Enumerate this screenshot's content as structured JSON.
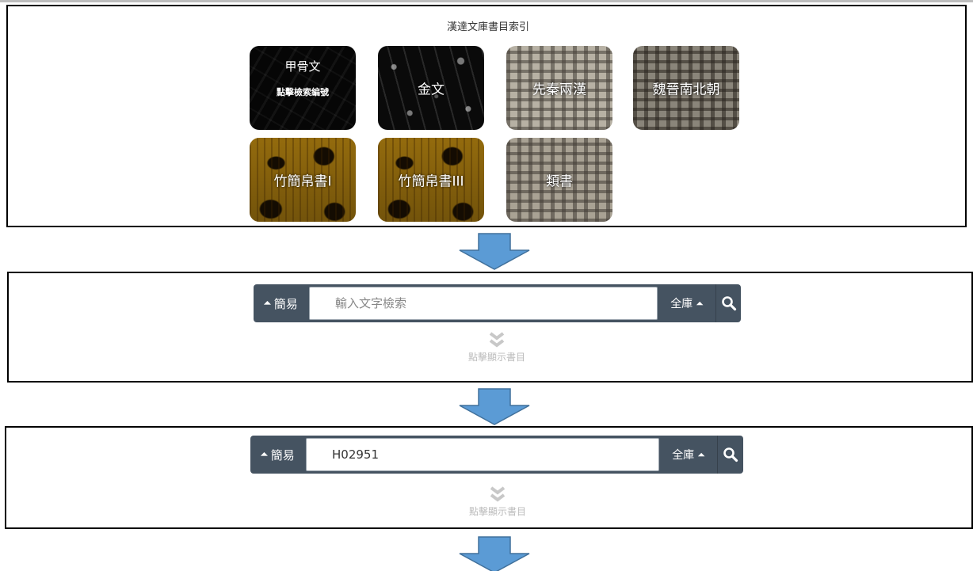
{
  "index": {
    "title": "漢達文庫書目索引",
    "tiles": [
      {
        "label": "甲骨文",
        "sublabel": "點擊檢索編號",
        "texture": "oracle-bone"
      },
      {
        "label": "金文",
        "texture": "bronze"
      },
      {
        "label": "先秦兩漢",
        "texture": "printed-text"
      },
      {
        "label": "魏晉南北朝",
        "texture": "printed-text"
      },
      {
        "label": "竹簡帛書I",
        "texture": "bamboo-slip"
      },
      {
        "label": "竹簡帛書III",
        "texture": "bamboo-slip"
      },
      {
        "label": "類書",
        "texture": "printed-text"
      }
    ]
  },
  "search_empty": {
    "mode_label": "簡易",
    "placeholder": "輸入文字檢索",
    "value": "",
    "scope_label": "全庫",
    "show_catalog_label": "點擊顯示書目"
  },
  "search_filled": {
    "mode_label": "簡易",
    "placeholder": "輸入文字檢索",
    "value": "H02951",
    "scope_label": "全庫",
    "show_catalog_label": "點擊顯示書目"
  },
  "icons": {
    "mode_toggle": "chevrons-up-icon",
    "scope_toggle": "chevrons-up-icon",
    "search": "magnifier-icon",
    "expand": "chevrons-down-icon",
    "flow_arrow": "down-arrow-icon"
  },
  "colors": {
    "search_bar": "#455361",
    "flow_arrow": "#5b9bd5",
    "panel_border": "#000000"
  }
}
